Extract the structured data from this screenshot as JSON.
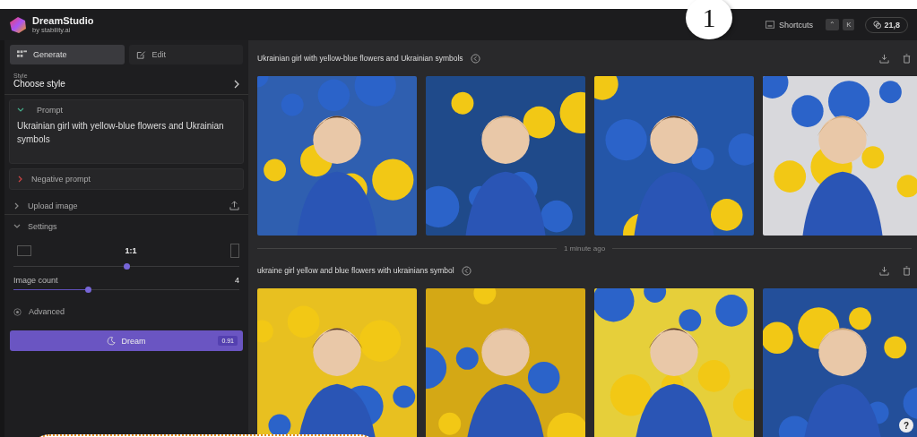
{
  "app": {
    "name": "DreamStudio",
    "byline": "by stability.ai"
  },
  "callout": {
    "number": "1"
  },
  "help": "?",
  "topbar": {
    "shortcuts": "Shortcuts",
    "keys": [
      "⌃",
      "K"
    ],
    "credits": "21,8"
  },
  "sidebar": {
    "tabs": [
      {
        "label": "Generate",
        "selected": true
      },
      {
        "label": "Edit",
        "selected": false
      }
    ],
    "style": {
      "label": "Style",
      "value": "Choose style"
    },
    "prompt": {
      "label": "Prompt",
      "expanded": true,
      "text": "Ukrainian girl with yellow-blue flowers and Ukrainian symbols"
    },
    "negative_prompt": {
      "label": "Negative prompt",
      "expanded": false
    },
    "upload": {
      "label": "Upload image",
      "expanded": false
    },
    "settings": {
      "label": "Settings",
      "expanded": true,
      "aspect": {
        "value": "1:1",
        "level": 0.5
      },
      "count": {
        "label": "Image count",
        "value": "4",
        "level": 0.33
      },
      "advanced": "Advanced"
    },
    "dream": {
      "label": "Dream",
      "cost": "0.91"
    }
  },
  "generations": [
    {
      "prompt": "Ukrainian girl with yellow-blue flowers and Ukrainian symbols"
    },
    {
      "separator": "1 minute ago",
      "prompt": "ukraine girl yellow and blue flowers with ukrainians symbol"
    }
  ]
}
